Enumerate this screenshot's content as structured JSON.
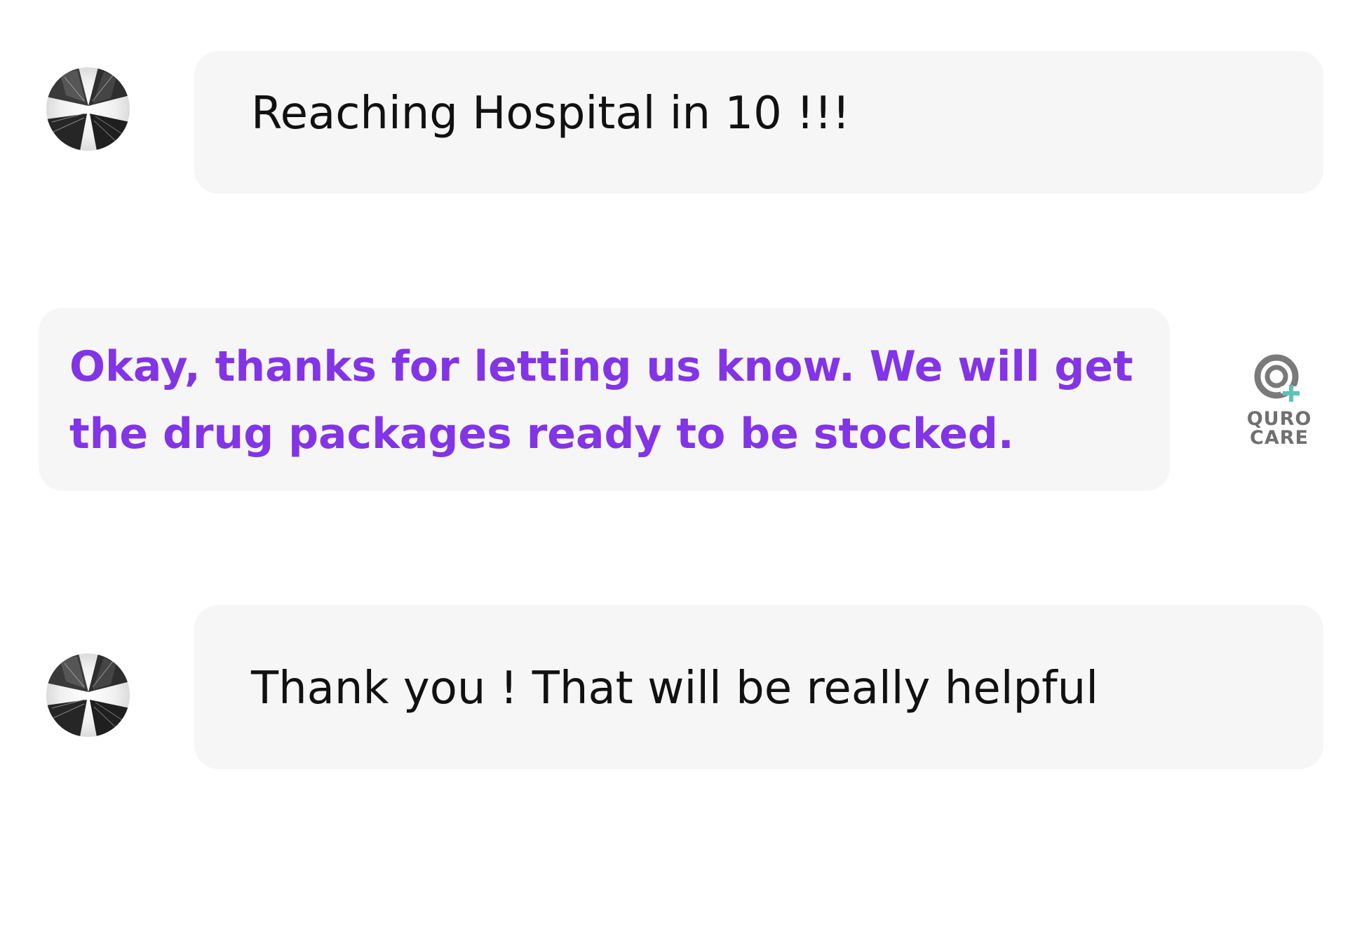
{
  "conversation": {
    "messages": [
      {
        "sender": "user",
        "text": "Reaching Hospital in 10 !!!",
        "avatar_icon": "user-avatar-icon"
      },
      {
        "sender": "bot",
        "lines": [
          "Okay, thanks for letting us know. We will get",
          "the drug packages ready to be stocked."
        ],
        "avatar_icon": "quro-care-logo"
      },
      {
        "sender": "user",
        "text": "Thank you ! That will be really helpful",
        "avatar_icon": "user-avatar-icon"
      }
    ],
    "bot_logo": {
      "line1": "QURO",
      "line2": "CARE"
    }
  },
  "colors": {
    "bubble_background": "#f6f6f6",
    "user_text": "#111111",
    "bot_text": "#8234e6",
    "logo_gray": "#707070",
    "logo_plus": "#5cc3b6"
  }
}
